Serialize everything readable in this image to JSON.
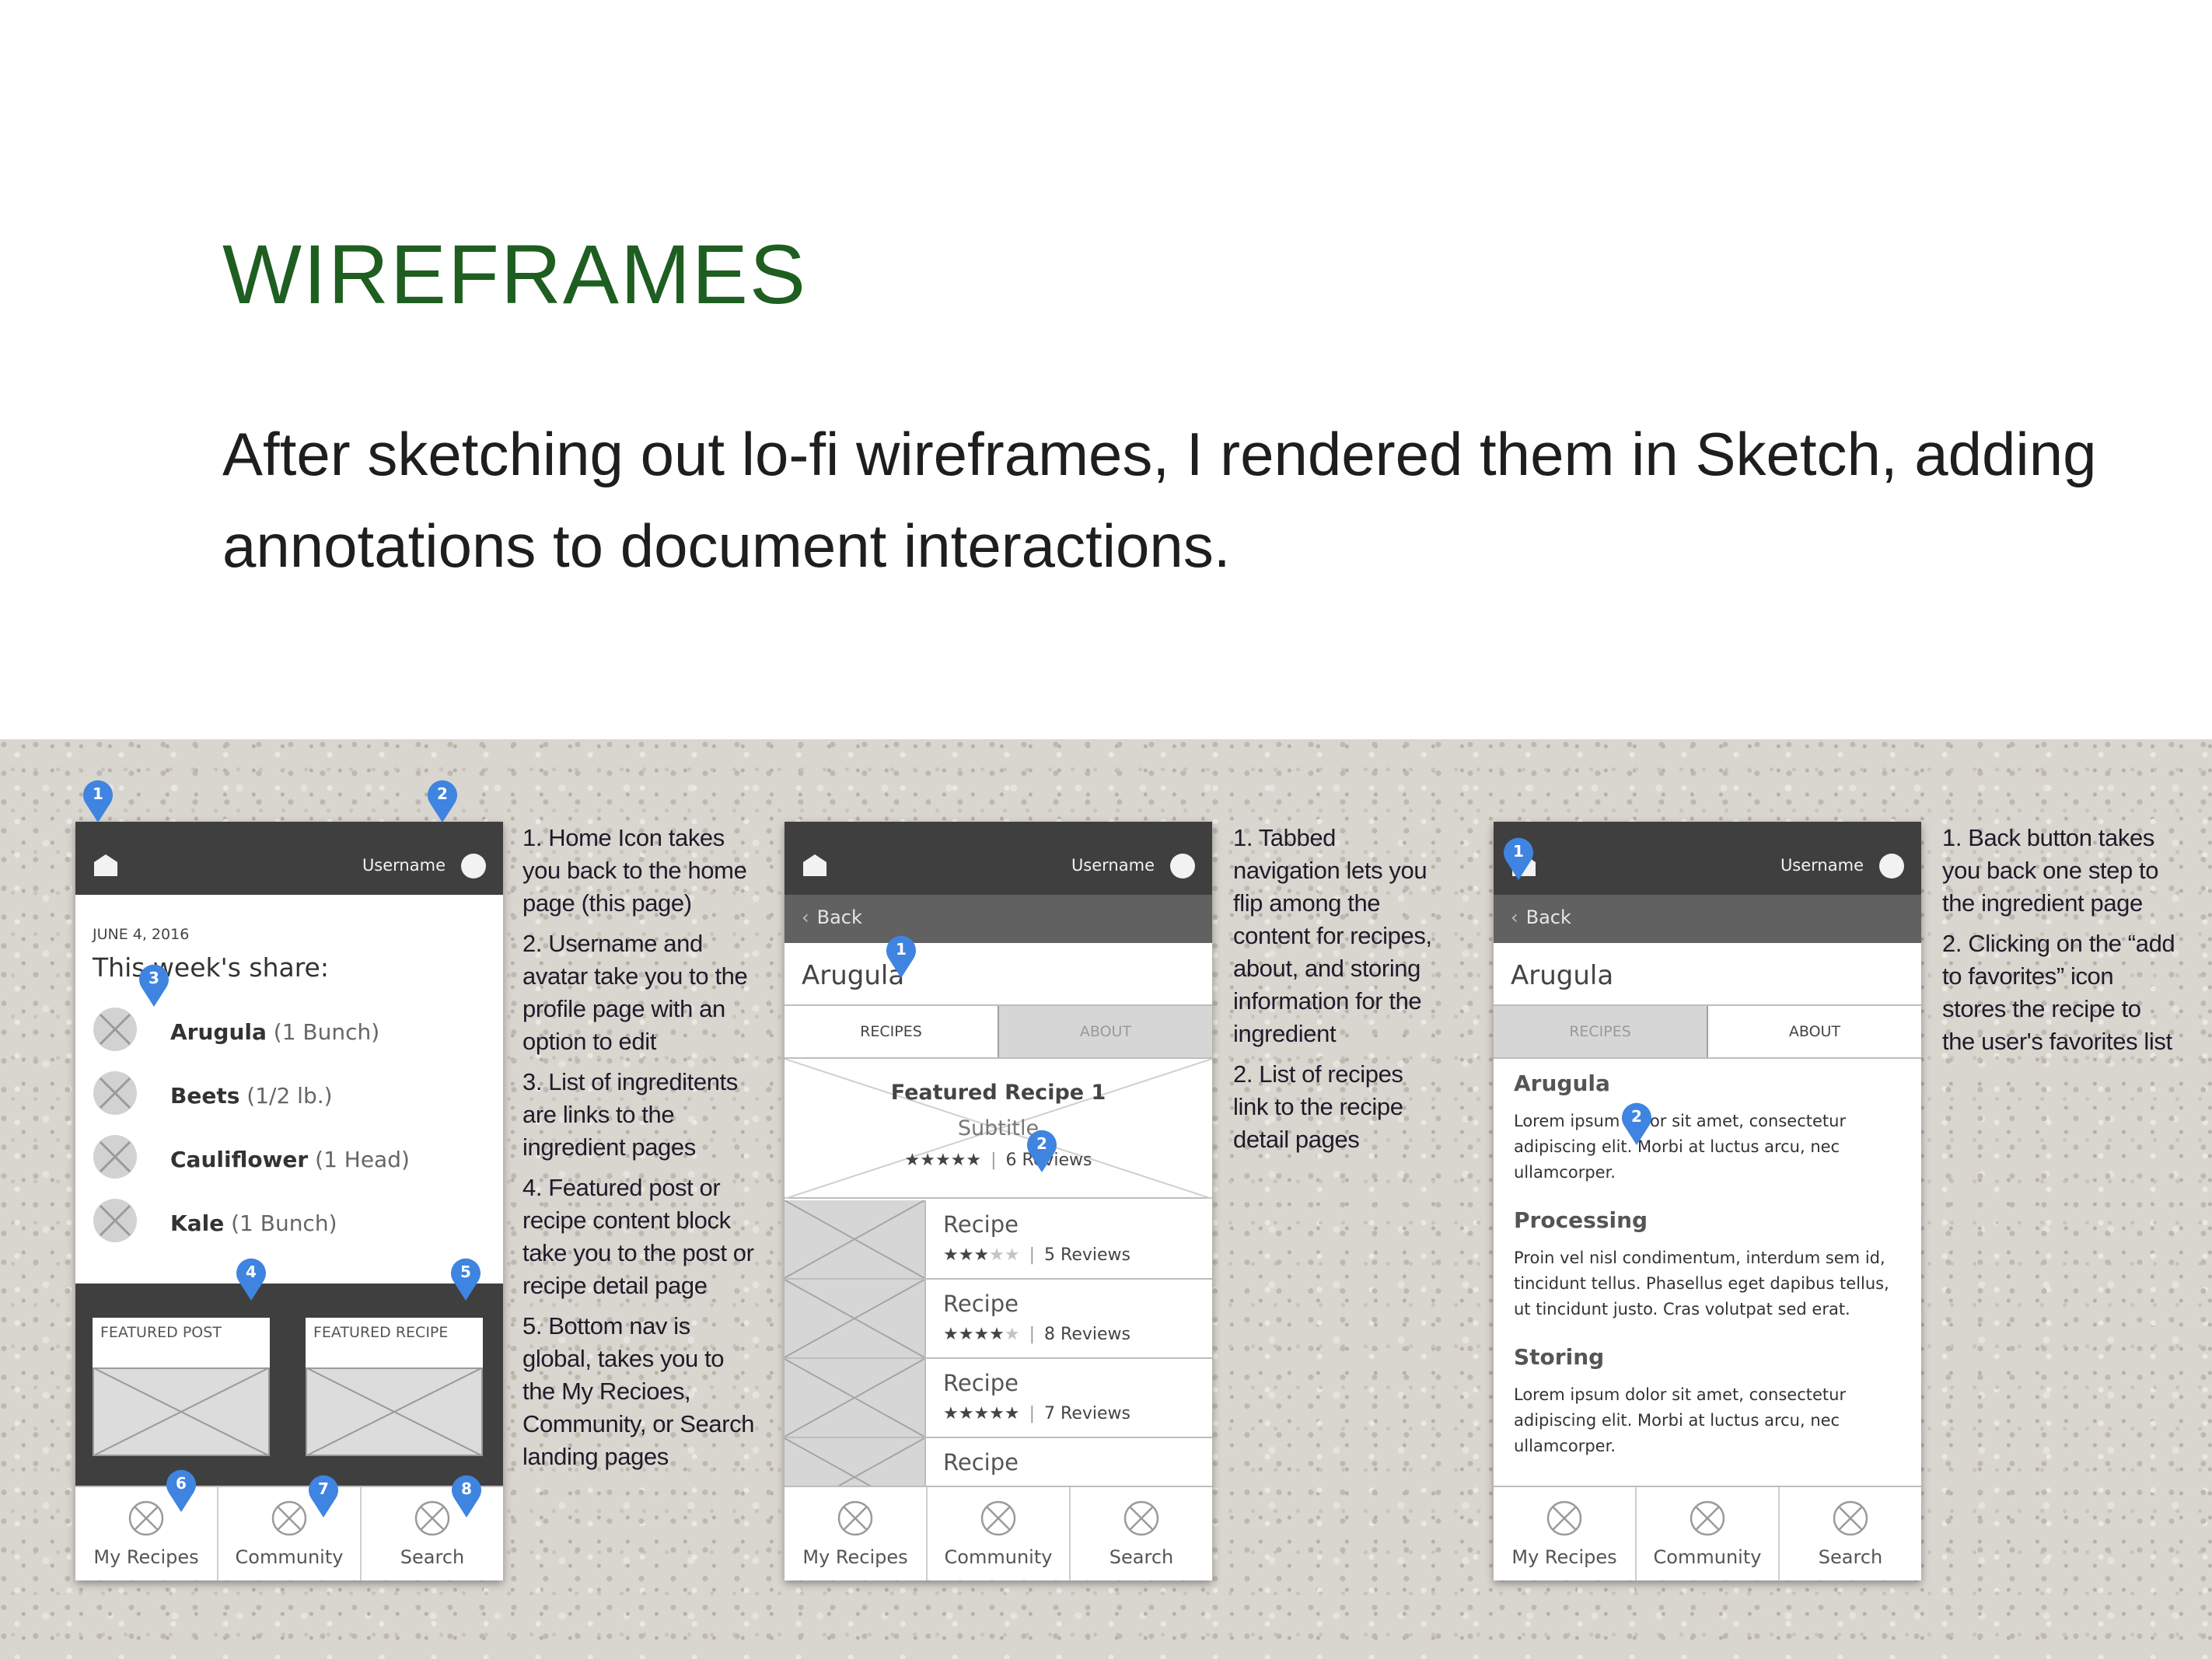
{
  "slide": {
    "title": "WIREFRAMES",
    "intro": "After sketching out lo-fi wireframes, I rendered them in Sketch, adding annotations to document interactions."
  },
  "colors": {
    "title_green": "#1e5e20",
    "pin_blue": "#3f84e0",
    "topbar_dark": "#3f3f3f"
  },
  "common": {
    "username": "Username",
    "back_label": "Back",
    "nav": [
      "My Recipes",
      "Community",
      "Search"
    ]
  },
  "phone1": {
    "date": "JUNE 4, 2016",
    "heading": "This week's share:",
    "ingredients": [
      {
        "name": "Arugula",
        "qty": "(1 Bunch)"
      },
      {
        "name": "Beets",
        "qty": "(1/2 lb.)"
      },
      {
        "name": "Cauliflower",
        "qty": "(1 Head)"
      },
      {
        "name": "Kale",
        "qty": "(1 Bunch)"
      }
    ],
    "featured_post": "FEATURED POST",
    "featured_recipe": "FEATURED RECIPE"
  },
  "phone2": {
    "title": "Arugula",
    "tabs": [
      "RECIPES",
      "ABOUT"
    ],
    "featured": {
      "title": "Featured Recipe 1",
      "subtitle": "Subtitle",
      "stars": "★★★★★",
      "reviews": "6 Reviews"
    },
    "recipes": [
      {
        "title": "Recipe",
        "stars": "★★★",
        "stars_dim": "★★",
        "reviews": "5 Reviews"
      },
      {
        "title": "Recipe",
        "stars": "★★★★",
        "stars_dim": "★",
        "reviews": "8 Reviews"
      },
      {
        "title": "Recipe",
        "stars": "★★★★★",
        "stars_dim": "",
        "reviews": "7 Reviews"
      },
      {
        "title": "Recipe",
        "stars": "",
        "stars_dim": "",
        "reviews": ""
      }
    ]
  },
  "phone3": {
    "title": "Arugula",
    "tabs": [
      "RECIPES",
      "ABOUT"
    ],
    "sections": [
      {
        "head": "Arugula",
        "body": "Lorem ipsum dolor sit amet, consectetur adipiscing elit. Morbi at luctus arcu, nec ullamcorper."
      },
      {
        "head": "Processing",
        "body": "Proin vel nisl condimentum, interdum sem id, tincidunt tellus. Phasellus eget dapibus tellus, ut tincidunt justo. Cras volutpat sed erat."
      },
      {
        "head": "Storing",
        "body": "Lorem ipsum dolor sit amet, consectetur adipiscing elit. Morbi at luctus arcu, nec ullamcorper."
      }
    ]
  },
  "notes1": [
    "1. Home Icon takes you back to the home page (this page)",
    "2. Username and avatar take you to the profile page with an option to edit",
    "3. List of ingreditents are links to the ingredient pages",
    "4. Featured post or recipe content block take you to the post or recipe detail page",
    "5. Bottom nav is global, takes you to the My Recioes, Community, or Search landing pages"
  ],
  "notes2": [
    "1. Tabbed navigation lets you flip among the content for recipes, about, and storing information for the ingredient",
    "2. List of recipes link to the recipe detail pages"
  ],
  "notes3": [
    "1. Back button takes you back one step to the ingredient page",
    "2. Clicking on the “add to favorites” icon stores the recipe to the user's favorites list"
  ],
  "pins": {
    "p1": [
      "1",
      "2",
      "3",
      "4",
      "5",
      "6",
      "7",
      "8"
    ],
    "p2": [
      "1",
      "2"
    ],
    "p3": [
      "1",
      "2"
    ]
  }
}
